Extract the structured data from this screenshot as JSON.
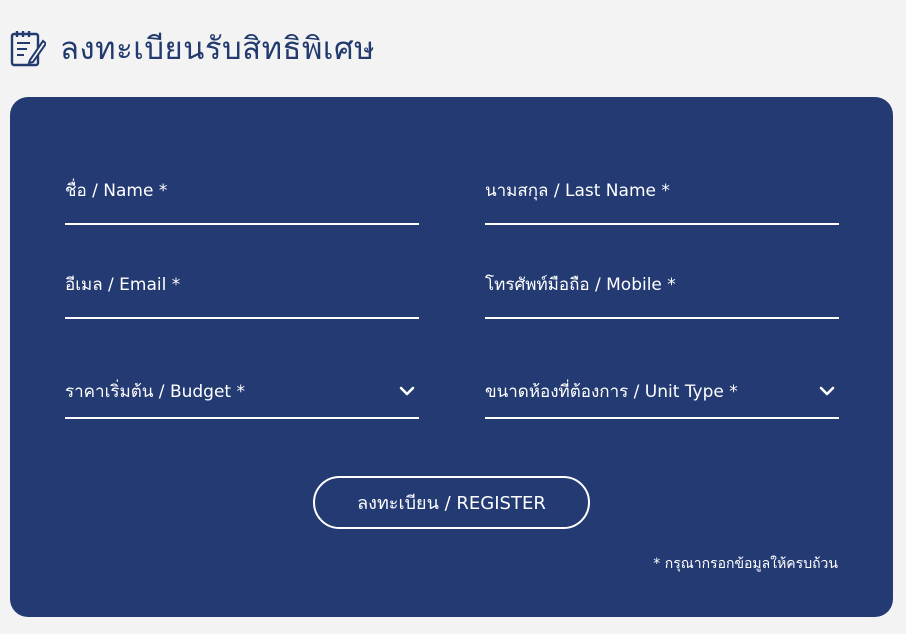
{
  "header": {
    "title": "ลงทะเบียนรับสิทธิพิเศษ",
    "icon": "notepad-pencil-icon"
  },
  "form": {
    "first_name_label": "ชื่อ / Name *",
    "last_name_label": "นามสกุล / Last Name *",
    "email_label": "อีเมล / Email *",
    "mobile_label": "โทรศัพท์มือถือ / Mobile *",
    "budget_label": "ราคาเริ่มต้น / Budget *",
    "unit_type_label": "ขนาดห้องที่ต้องการ / Unit Type *",
    "register_label": "ลงทะเบียน / REGISTER",
    "required_note": "* กรุณากรอกข้อมูลให้ครบถ้วน"
  },
  "colors": {
    "panel_bg": "#233a72",
    "title_text": "#223a6e",
    "page_bg": "#f3f3f3",
    "form_text": "#ffffff"
  }
}
